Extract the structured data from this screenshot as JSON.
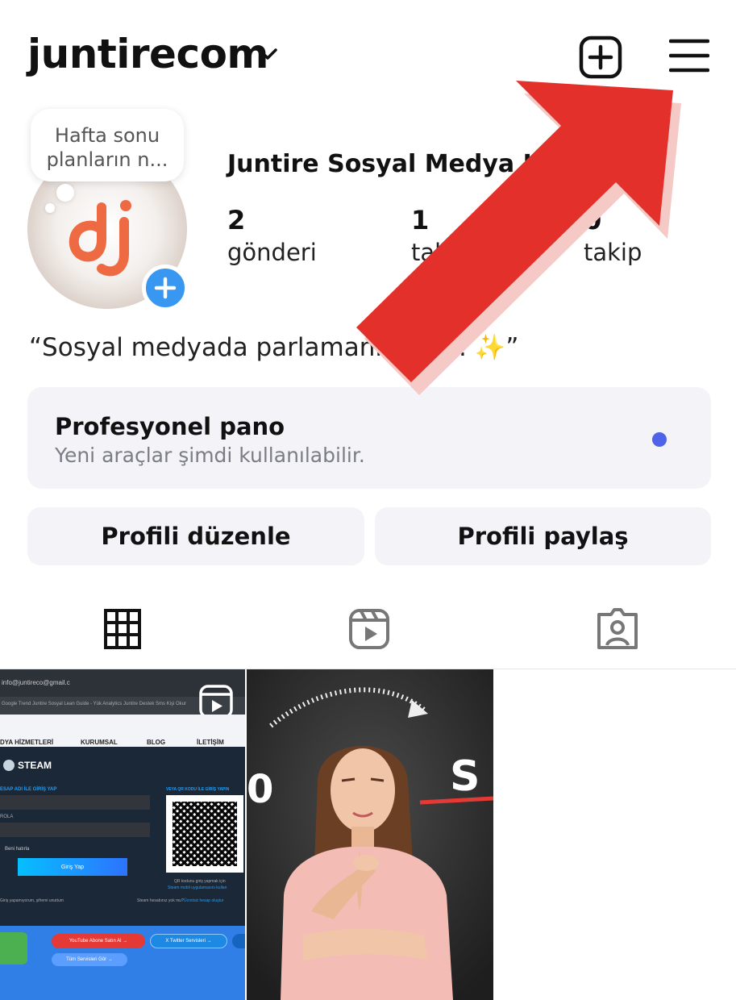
{
  "header": {
    "username": "juntirecom"
  },
  "note_bubble": {
    "line1": "Hafta sonu",
    "line2": "planların n..."
  },
  "profile": {
    "full_name": "Juntire Sosyal Medya Hiz",
    "stats": [
      {
        "value": "2",
        "label": "gönderi"
      },
      {
        "value": "1",
        "label": "tak"
      },
      {
        "value": "0",
        "label": "takip"
      }
    ],
    "bio": "“Sosyal medyada parlamanın       yolu. ✨”"
  },
  "pro_dashboard": {
    "title": "Profesyonel pano",
    "subtitle": "Yeni araçlar şimdi kullanılabilir."
  },
  "buttons": {
    "edit_profile": "Profili düzenle",
    "share_profile": "Profili paylaş"
  },
  "colors": {
    "accent_blue": "#3897f0",
    "notification_dot": "#4f63e8",
    "logo_orange": "#ee6a43",
    "annotation_arrow": "#e4302a"
  },
  "icons": {
    "new_post": "plus-square-icon",
    "menu": "hamburger-menu-icon",
    "grid_tab": "grid-icon",
    "reels_tab": "reels-icon",
    "tagged_tab": "tagged-icon"
  },
  "post1": {
    "url_bar": "info@juntireco@gmail.c",
    "bookmarks": "Google Trend   Juntire Sosyal   Lean Guide - Yük   Analytics   Juntire Destek   Sms Kişi Okur",
    "nav": [
      "DYA HİZMETLERİ",
      "KURUMSAL",
      "BLOG",
      "İLETİŞİM"
    ],
    "steam_title": "STEAM",
    "login_label": "ESAP ADI İLE GİRİŞ YAP",
    "password_label": "ROLA",
    "remember": "Beni hatırla",
    "login_button": "Giriş Yap",
    "qr_label": "VEYA QR KODU İLE GİRİŞ YAPIN",
    "qr_caption1": "QR kodunu giriş yapmak için",
    "qr_caption2": "Steam mobil uygulamasını kullan",
    "forgot": "Giriş yapamıyorum, şifremi unuttum",
    "no_account": "Steam hesabınız yok mu?",
    "create_account": "Ücretsiz hesap oluştur",
    "pill_youtube": "YouTube Abone Satın Al →",
    "pill_twitter": "X Twitter Servisleri →",
    "pill_all": "Tüm Servisleri Gör →"
  },
  "post2": {
    "partial_left": "0",
    "partial_right": "S"
  }
}
